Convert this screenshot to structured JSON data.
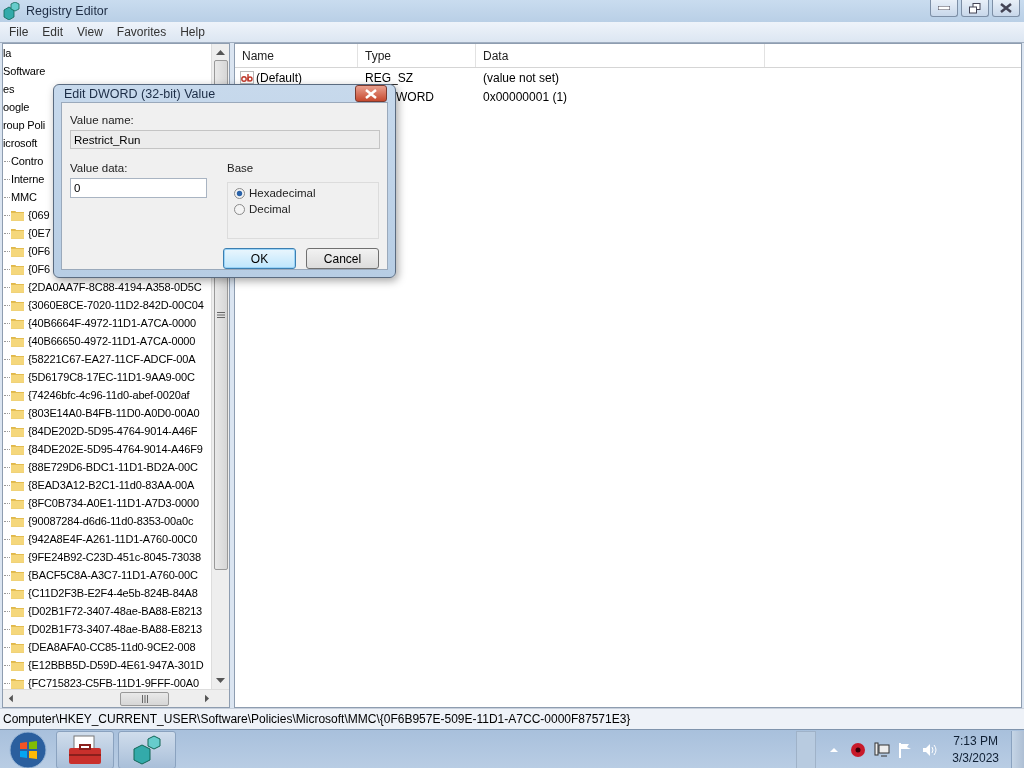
{
  "window": {
    "title": "Registry Editor"
  },
  "menu": [
    "File",
    "Edit",
    "View",
    "Favorites",
    "Help"
  ],
  "tree": [
    {
      "label": "la"
    },
    {
      "label": "Software"
    },
    {
      "label": "es"
    },
    {
      "label": "oogle"
    },
    {
      "label": "roup Poli"
    },
    {
      "label": "icrosoft",
      "children": [
        {
          "label": "Contro"
        },
        {
          "label": "Interne"
        },
        {
          "label": "MMC",
          "children": [
            {
              "label": "{069"
            },
            {
              "label": "{0E7"
            },
            {
              "label": "{0F6"
            },
            {
              "label": "{0F6"
            },
            {
              "label": "{2DA0AA7F-8C88-4194-A358-0D5C"
            },
            {
              "label": "{3060E8CE-7020-11D2-842D-00C04"
            },
            {
              "label": "{40B6664F-4972-11D1-A7CA-0000"
            },
            {
              "label": "{40B66650-4972-11D1-A7CA-0000"
            },
            {
              "label": "{58221C67-EA27-11CF-ADCF-00A"
            },
            {
              "label": "{5D6179C8-17EC-11D1-9AA9-00C"
            },
            {
              "label": "{74246bfc-4c96-11d0-abef-0020af"
            },
            {
              "label": "{803E14A0-B4FB-11D0-A0D0-00A0"
            },
            {
              "label": "{84DE202D-5D95-4764-9014-A46F"
            },
            {
              "label": "{84DE202E-5D95-4764-9014-A46F9"
            },
            {
              "label": "{88E729D6-BDC1-11D1-BD2A-00C"
            },
            {
              "label": "{8EAD3A12-B2C1-11d0-83AA-00A"
            },
            {
              "label": "{8FC0B734-A0E1-11D1-A7D3-0000"
            },
            {
              "label": "{90087284-d6d6-11d0-8353-00a0c"
            },
            {
              "label": "{942A8E4F-A261-11D1-A760-00C0"
            },
            {
              "label": "{9FE24B92-C23D-451c-8045-73038"
            },
            {
              "label": "{BACF5C8A-A3C7-11D1-A760-00C"
            },
            {
              "label": "{C11D2F3B-E2F4-4e5b-824B-84A8"
            },
            {
              "label": "{D02B1F72-3407-48ae-BA88-E8213"
            },
            {
              "label": "{D02B1F73-3407-48ae-BA88-E8213"
            },
            {
              "label": "{DEA8AFA0-CC85-11d0-9CE2-008"
            },
            {
              "label": "{E12BBB5D-D59D-4E61-947A-301D"
            },
            {
              "label": "{FC715823-C5FB-11D1-9FFF-00A0"
            }
          ]
        }
      ]
    }
  ],
  "list": {
    "columns": [
      "Name",
      "Type",
      "Data"
    ],
    "rows": [
      {
        "kind": "string",
        "name": "(Default)",
        "type": "REG_SZ",
        "data": "(value not set)"
      },
      {
        "kind": "covered",
        "type": "WORD",
        "data": "0x00000001 (1)"
      }
    ]
  },
  "status_bar": "Computer\\HKEY_CURRENT_USER\\Software\\Policies\\Microsoft\\MMC\\{0F6B957E-509E-11D1-A7CC-0000F87571E3}",
  "dialog": {
    "title": "Edit DWORD (32-bit) Value",
    "value_name_label": "Value name:",
    "value_name": "Restrict_Run",
    "value_data_label": "Value data:",
    "value_data": "0",
    "base_label": "Base",
    "base_options": [
      {
        "label": "Hexadecimal",
        "selected": true
      },
      {
        "label": "Decimal",
        "selected": false
      }
    ],
    "buttons": [
      {
        "label": "OK",
        "default": true
      },
      {
        "label": "Cancel",
        "default": false
      }
    ]
  },
  "taskbar": {
    "time": "7:13 PM",
    "date": "3/3/2023"
  }
}
